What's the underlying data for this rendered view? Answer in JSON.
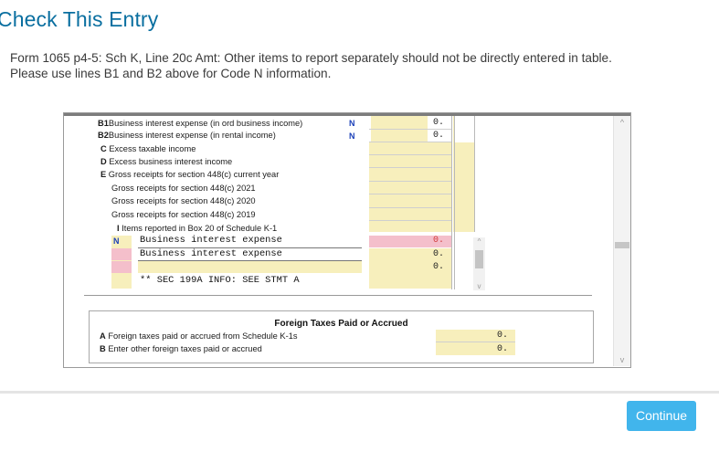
{
  "dialog": {
    "title": "Check This Entry",
    "message_line1": "Form 1065 p4-5: Sch K, Line 20c Amt: Other items to report separately should not be directly entered in table.",
    "message_line2": "Please use lines B1 and B2 above for Code N information."
  },
  "form": {
    "rows": [
      {
        "label": "B1",
        "text": "Business interest expense (in ord business income)",
        "code": "N",
        "value": "0."
      },
      {
        "label": "B2",
        "text": "Business interest expense (in rental income)",
        "code": "N",
        "value": "0."
      },
      {
        "label": "C",
        "text": "Excess taxable income"
      },
      {
        "label": "D",
        "text": "Excess business interest income"
      },
      {
        "label": "E",
        "text": "Gross receipts for section 448(c) current year"
      },
      {
        "label": "",
        "text": "Gross receipts for section 448(c) 2021"
      },
      {
        "label": "",
        "text": "Gross receipts for section 448(c) 2020"
      },
      {
        "label": "",
        "text": "Gross receipts for section 448(c) 2019"
      }
    ],
    "table_header_label": "I",
    "table_header_text": "Items reported in Box 20 of Schedule K-1",
    "table_rows": [
      {
        "code": "N",
        "description": "Business interest expense",
        "value": "0."
      },
      {
        "code": "",
        "description": "Business interest expense",
        "value": "0."
      },
      {
        "code": "",
        "description": "",
        "value": "0."
      },
      {
        "code": "",
        "description": "** SEC 199A INFO: SEE STMT A",
        "value": ""
      }
    ],
    "foreign": {
      "title": "Foreign Taxes Paid or Accrued",
      "rows": [
        {
          "label": "A",
          "text": "Foreign taxes paid or accrued from Schedule K-1s",
          "value": "0."
        },
        {
          "label": "B",
          "text": "Enter other foreign taxes paid or accrued",
          "value": "0."
        }
      ]
    }
  },
  "buttons": {
    "continue": "Continue"
  },
  "colors": {
    "title": "#0a6fa0",
    "button": "#41b5ec",
    "field_yellow": "#f7efbc",
    "field_pink": "#f4bfcb",
    "code_blue": "#1a3fb8"
  }
}
